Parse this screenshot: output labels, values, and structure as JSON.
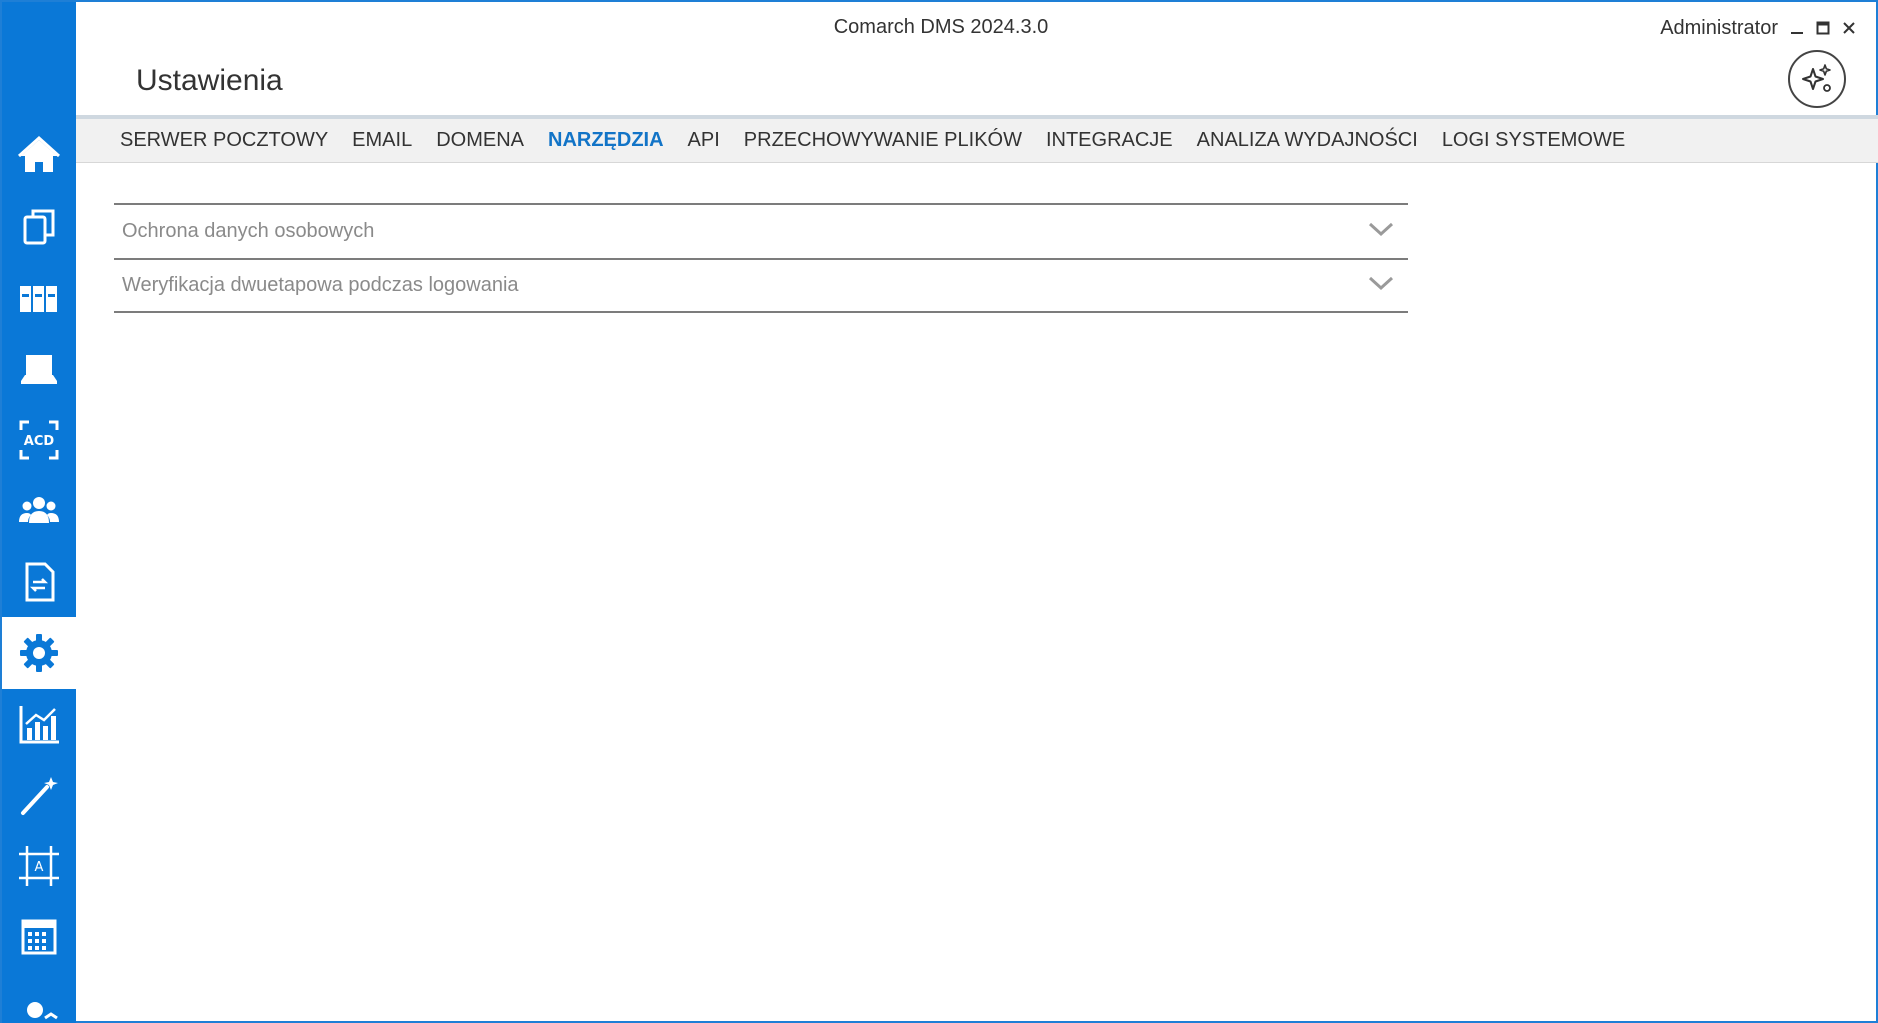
{
  "window": {
    "app_title": "Comarch DMS 2024.3.0",
    "user_name": "Administrator"
  },
  "header": {
    "page_title": "Ustawienia"
  },
  "sidebar": {
    "items": [
      {
        "name": "home",
        "icon": "home-icon"
      },
      {
        "name": "documents",
        "icon": "documents-icon"
      },
      {
        "name": "repository",
        "icon": "binders-icon"
      },
      {
        "name": "workstation",
        "icon": "laptop-icon"
      },
      {
        "name": "acd",
        "icon": "acd-scan-icon",
        "label": "ACD"
      },
      {
        "name": "users",
        "icon": "users-icon"
      },
      {
        "name": "document-exchange",
        "icon": "document-sync-icon"
      },
      {
        "name": "settings",
        "icon": "gear-icon",
        "active": true
      },
      {
        "name": "reports",
        "icon": "chart-icon"
      },
      {
        "name": "wizard",
        "icon": "magic-wand-icon"
      },
      {
        "name": "designer",
        "icon": "frame-designer-icon",
        "label": "A"
      },
      {
        "name": "calendar",
        "icon": "calendar-icon"
      },
      {
        "name": "more",
        "icon": "person-partial-icon"
      }
    ]
  },
  "tabs": [
    {
      "label": "SERWER POCZTOWY",
      "active": false
    },
    {
      "label": "EMAIL",
      "active": false
    },
    {
      "label": "DOMENA",
      "active": false
    },
    {
      "label": "NARZĘDZIA",
      "active": true
    },
    {
      "label": "API",
      "active": false
    },
    {
      "label": "PRZECHOWYWANIE PLIKÓW",
      "active": false
    },
    {
      "label": "INTEGRACJE",
      "active": false
    },
    {
      "label": "ANALIZA WYDAJNOŚCI",
      "active": false
    },
    {
      "label": "LOGI SYSTEMOWE",
      "active": false
    }
  ],
  "sections": [
    {
      "label": "Ochrona danych osobowych",
      "expanded": false
    },
    {
      "label": "Weryfikacja dwuetapowa podczas logowania",
      "expanded": false
    }
  ],
  "colors": {
    "sidebar": "#0a78d7",
    "accent": "#1274c7",
    "border": "#1e7fd6"
  }
}
